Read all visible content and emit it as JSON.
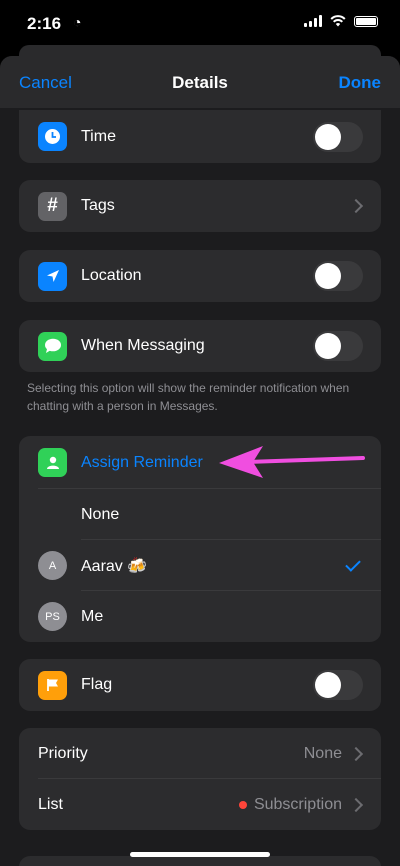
{
  "status_bar": {
    "time": "2:16"
  },
  "nav": {
    "cancel": "Cancel",
    "title": "Details",
    "done": "Done"
  },
  "rows": {
    "time": "Time",
    "tags": "Tags",
    "location": "Location",
    "messaging": "When Messaging"
  },
  "footnote": "Selecting this option will show the reminder notification when chatting with a person in Messages.",
  "assign": {
    "title": "Assign Reminder",
    "none": "None",
    "people": [
      {
        "initials": "A",
        "name": "Aarav 🍻",
        "selected": true
      },
      {
        "initials": "PS",
        "name": "Me",
        "selected": false
      }
    ]
  },
  "flag": "Flag",
  "priority": {
    "label": "Priority",
    "value": "None"
  },
  "list": {
    "label": "List",
    "value": "Subscription",
    "color": "#ff453a"
  },
  "colors": {
    "accent": "#0a84ff",
    "annotation": "#f04ee0"
  }
}
